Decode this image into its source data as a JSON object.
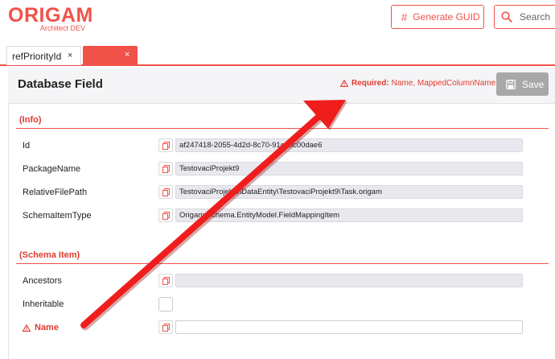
{
  "header": {
    "logo_main": "ORIGAM",
    "logo_sub": "Architect DEV",
    "generate_guid_label": "Generate GUID",
    "search_label": "Search"
  },
  "tabs": [
    {
      "label": "refPriorityId",
      "close": "×"
    },
    {
      "label": "",
      "close": "×"
    }
  ],
  "editor": {
    "title": "Database Field",
    "required_prefix": "Required:",
    "required_fields": "Name, MappedColumnName",
    "save_label": "Save"
  },
  "sections": [
    {
      "title": "(Info)",
      "properties": [
        {
          "label": "Id",
          "value": "af247418-2055-4d2d-8c70-91c1bc00dae6"
        },
        {
          "label": "PackageName",
          "value": "TestovaciProjekt9"
        },
        {
          "label": "RelativeFilePath",
          "value": "TestovaciProjekt9\\DataEntity\\TestovaciProjekt9\\Task.origam"
        },
        {
          "label": "SchemaItemType",
          "value": "Origam.Schema.EntityModel.FieldMappingItem"
        }
      ]
    },
    {
      "title": "(Schema Item)",
      "properties": [
        {
          "label": "Ancestors",
          "value": ""
        },
        {
          "label": "Inheritable",
          "value": ""
        },
        {
          "label": "Name",
          "value": ""
        }
      ]
    }
  ],
  "colors": {
    "accent": "#f0524a",
    "error": "#e13b2e",
    "save_disabled": "#a8a8a8",
    "readonly_field": "#e9e8ef",
    "annotation_arrow": "#f01d1d"
  }
}
